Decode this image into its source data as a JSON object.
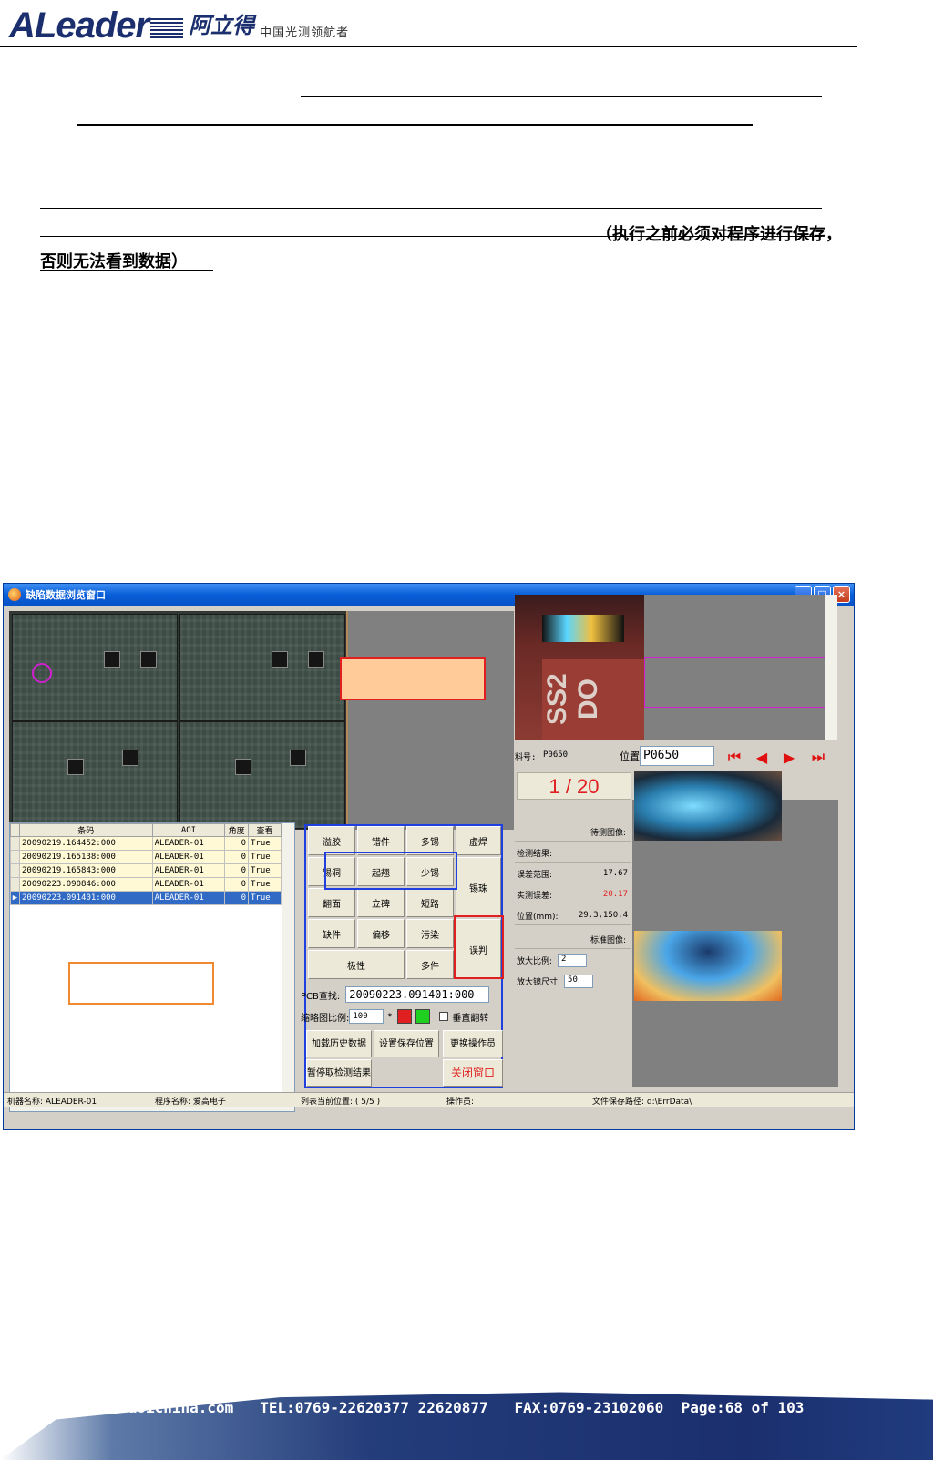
{
  "header": {
    "logo_text": "ALeader",
    "logo_cn": "阿立得",
    "slogan": "中国光测领航者"
  },
  "document": {
    "note_line1": "（执行之前必须对程序进行保存，",
    "note_line2": "否则无法看到数据）"
  },
  "window": {
    "title": "缺陷数据浏览窗口",
    "controls": [
      "_",
      "□",
      "×"
    ],
    "table": {
      "columns": [
        "条码",
        "AOI",
        "角度",
        "查看"
      ],
      "rows": [
        [
          "20090219.164452:000",
          "ALEADER-01",
          "0",
          "True"
        ],
        [
          "20090219.165138:000",
          "ALEADER-01",
          "0",
          "True"
        ],
        [
          "20090219.165843:000",
          "ALEADER-01",
          "0",
          "True"
        ],
        [
          "20090223.090846:000",
          "ALEADER-01",
          "0",
          "True"
        ],
        [
          "20090223.091401:000",
          "ALEADER-01",
          "0",
          "True"
        ]
      ],
      "selected_row": 4
    },
    "defect_buttons": {
      "b1": "溢胶",
      "b2": "错件",
      "b3": "多锡",
      "b4": "虚焊",
      "b5": "锡洞",
      "b6": "起翘",
      "b7": "少锡",
      "b8": "锡珠",
      "b9": "翻面",
      "b10": "立碑",
      "b11": "短路",
      "b12": "缺件",
      "b13": "偏移",
      "b14": "污染",
      "b15": "误判",
      "b16": "极性",
      "b17": "多件"
    },
    "pcb_query_label": "PCB查找:",
    "pcb_query_value": "20090223.091401:000",
    "thumb_ratio_label": "缩略图比例:",
    "thumb_ratio_value": "100",
    "thumb_ratio_unit": "*",
    "vflip_label": "垂直翻转",
    "btn_load_history": "加载历史数据",
    "btn_set_save": "设置保存位置",
    "btn_change_operator": "更换操作员",
    "btn_pause": "暂停取检测结果",
    "btn_close": "关闭窗口",
    "part_label": "料号:",
    "part_value": "P0650",
    "position_label": "位置",
    "position_value": "P0650",
    "counter": "1 / 20",
    "img_test_label": "待测图像:",
    "result_label": "检测结果:",
    "tolerance_label": "误差范围:",
    "tolerance_value": "17.67",
    "actual_label": "实测误差:",
    "actual_value": "20.17",
    "pos_mm_label": "位置(mm):",
    "pos_mm_value": "29.3,150.4",
    "img_std_label": "标准图像:",
    "zoom_ratio_label": "放大比例:",
    "zoom_ratio_value": "2",
    "zoom_size_label": "放大镜尺寸:",
    "zoom_size_value": "50",
    "photo_code": "SS2 DO",
    "status": {
      "machine": "机器名称: ALEADER-01",
      "program": "程序名称: 爱高电子",
      "list_pos": "列表当前位置: ( 5/5 )",
      "operator": "操作员:",
      "file_path": "文件保存路径: d:\\ErrData\\"
    }
  },
  "footer": {
    "text": "Http:www.aoichina.com   TEL:0769-22620377 22620877   FAX:0769-23102060  Page:68 of 103"
  },
  "colors": {
    "brand": "#1b2f6e",
    "highlight_blue": "#1f3fe0",
    "highlight_red": "#e02020",
    "highlight_orange": "#f08a30",
    "peach": "#ffcc99"
  }
}
